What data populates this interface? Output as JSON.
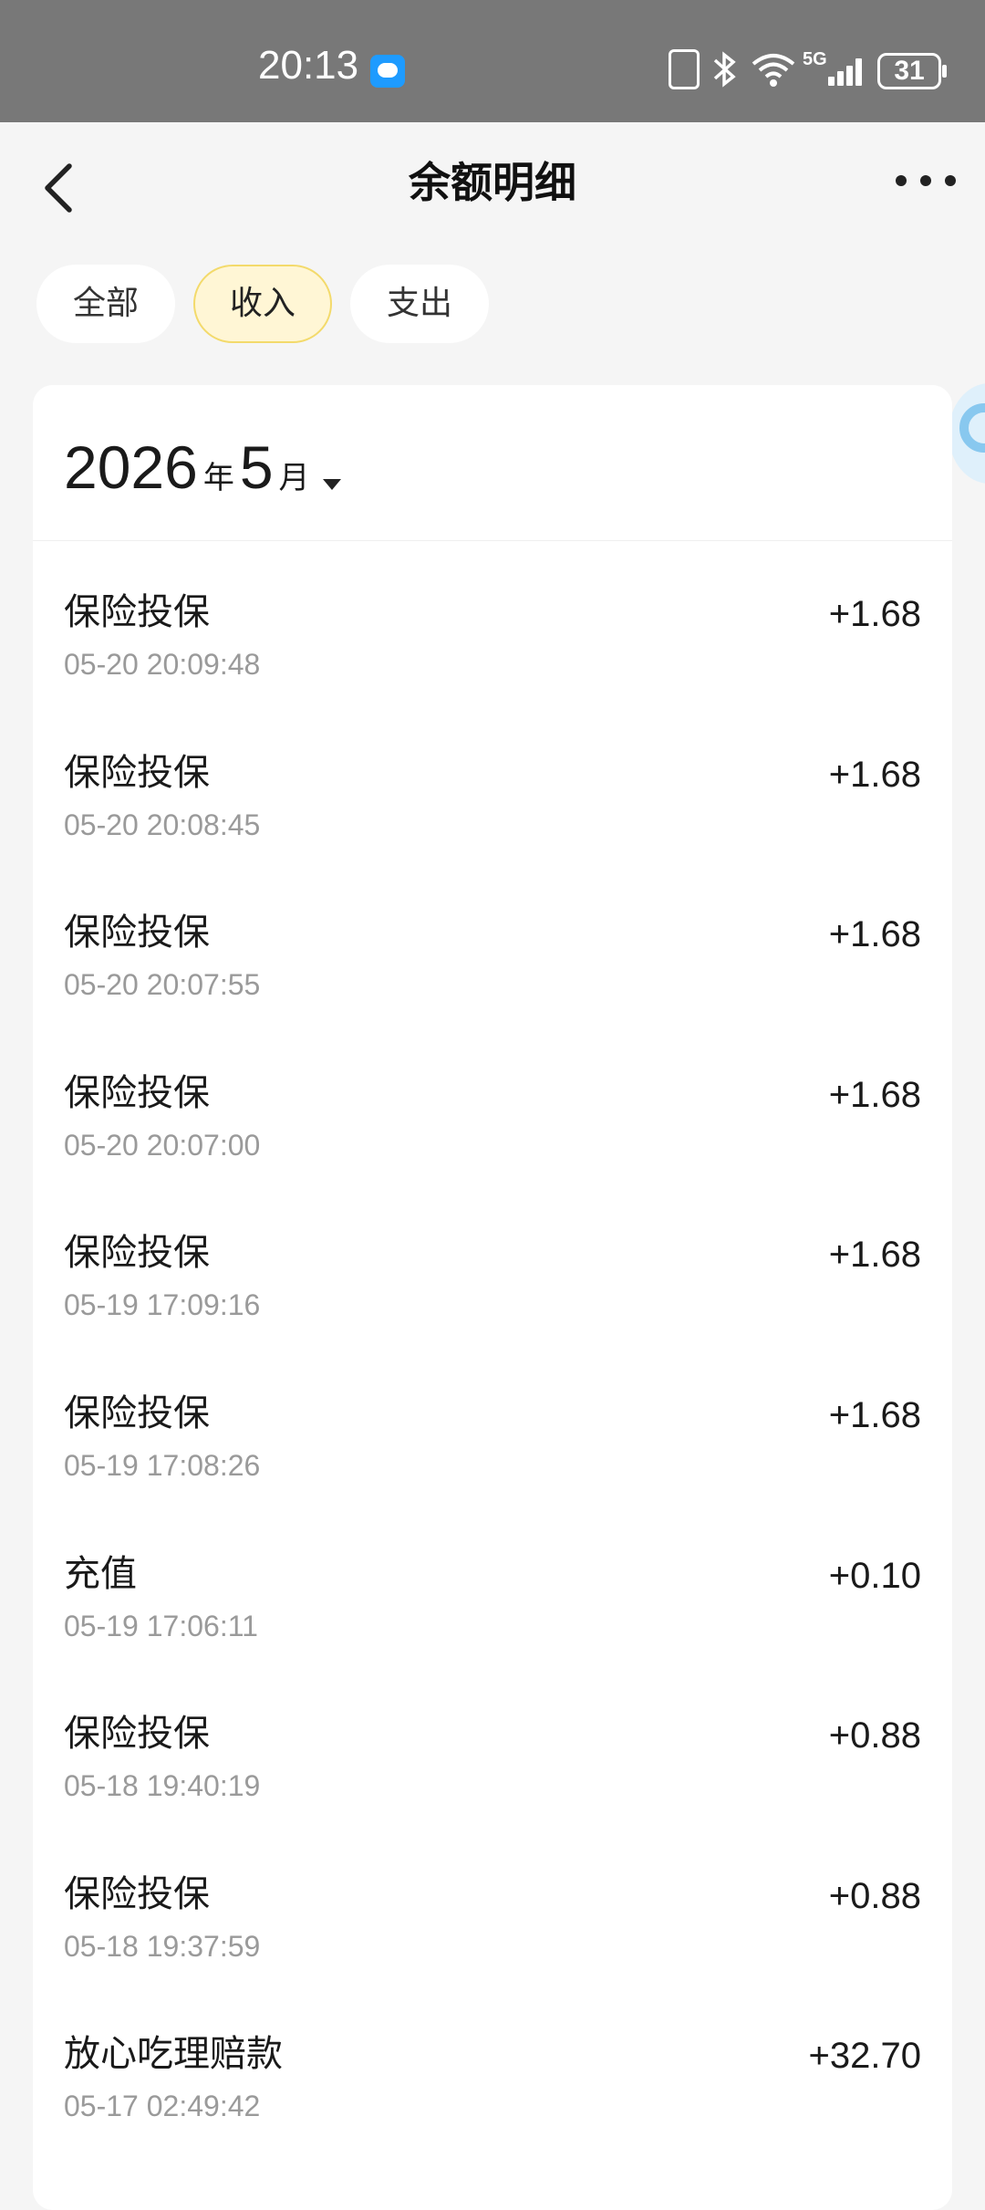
{
  "status": {
    "time": "20:13",
    "network": "5G",
    "battery": "31"
  },
  "header": {
    "title": "余额明细"
  },
  "tabs": [
    {
      "label": "全部",
      "active": false
    },
    {
      "label": "收入",
      "active": true
    },
    {
      "label": "支出",
      "active": false
    }
  ],
  "month": {
    "year": "2026",
    "year_unit": "年",
    "month": "5",
    "month_unit": "月"
  },
  "transactions": [
    {
      "title": "保险投保",
      "time": "05-20 20:09:48",
      "amount": "+1.68"
    },
    {
      "title": "保险投保",
      "time": "05-20 20:08:45",
      "amount": "+1.68"
    },
    {
      "title": "保险投保",
      "time": "05-20 20:07:55",
      "amount": "+1.68"
    },
    {
      "title": "保险投保",
      "time": "05-20 20:07:00",
      "amount": "+1.68"
    },
    {
      "title": "保险投保",
      "time": "05-19 17:09:16",
      "amount": "+1.68"
    },
    {
      "title": "保险投保",
      "time": "05-19 17:08:26",
      "amount": "+1.68"
    },
    {
      "title": "充值",
      "time": "05-19 17:06:11",
      "amount": "+0.10"
    },
    {
      "title": "保险投保",
      "time": "05-18 19:40:19",
      "amount": "+0.88"
    },
    {
      "title": "保险投保",
      "time": "05-18 19:37:59",
      "amount": "+0.88"
    },
    {
      "title": "放心吃理赔款",
      "time": "05-17 02:49:42",
      "amount": "+32.70"
    }
  ],
  "colors": {
    "status_bar": "#787878",
    "background": "#f5f5f5",
    "active_tab_bg": "#fff6d5",
    "active_tab_border": "#f3da6b",
    "secondary_text": "#9a9a9a"
  }
}
